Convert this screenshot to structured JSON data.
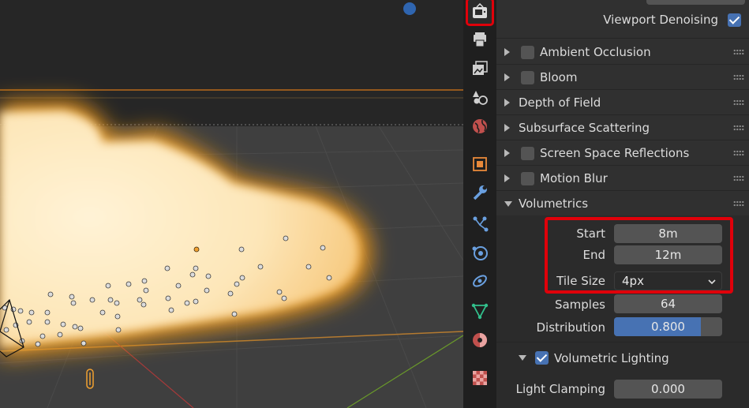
{
  "panel": {
    "viewport_denoising": {
      "label": "Viewport Denoising",
      "checked": true
    },
    "sections": [
      {
        "label": "Ambient Occlusion",
        "has_checkbox": true
      },
      {
        "label": "Bloom",
        "has_checkbox": true
      },
      {
        "label": "Depth of Field",
        "has_checkbox": false
      },
      {
        "label": "Subsurface Scattering",
        "has_checkbox": false
      },
      {
        "label": "Screen Space Reflections",
        "has_checkbox": true
      },
      {
        "label": "Motion Blur",
        "has_checkbox": true
      },
      {
        "label": "Volumetrics",
        "has_checkbox": false,
        "expanded": true
      }
    ],
    "volumetrics": {
      "start": {
        "label": "Start",
        "value": "8m"
      },
      "end": {
        "label": "End",
        "value": "12m"
      },
      "tile_size": {
        "label": "Tile Size",
        "value": "4px"
      },
      "samples": {
        "label": "Samples",
        "value": "64"
      },
      "distribution": {
        "label": "Distribution",
        "value": "0.800",
        "fraction": 0.8
      },
      "volumetric_lighting": {
        "label": "Volumetric Lighting",
        "checked": true
      },
      "light_clamping": {
        "label": "Light Clamping",
        "value": "0.000"
      }
    }
  },
  "tabs": [
    "render-properties-icon",
    "output-properties-icon",
    "view-layer-icon",
    "scene-icon",
    "world-icon",
    "object-icon",
    "modifier-icon",
    "particles-icon",
    "physics-icon",
    "constraints-icon",
    "object-data-icon",
    "material-icon",
    "texture-icon"
  ],
  "colors": {
    "accent": "#4772b3",
    "highlight": "#e0000a",
    "fire": "#f5b040"
  }
}
